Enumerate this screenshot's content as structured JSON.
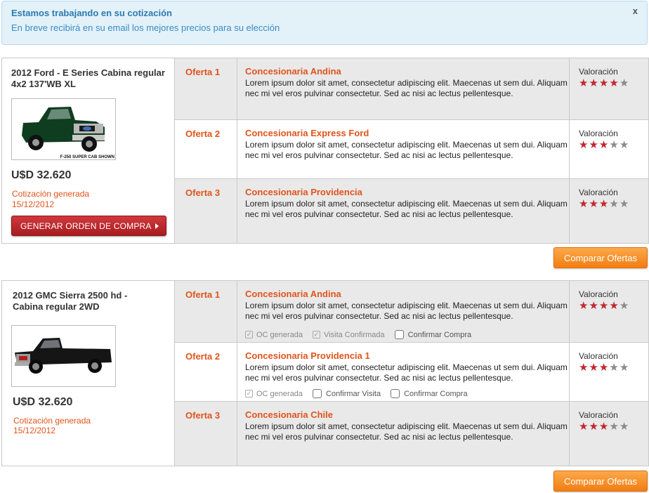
{
  "alert": {
    "title": "Estamos trabajando en su cotización",
    "text": "En breve recibirá en su email los mejores precios para su elección",
    "close": "x"
  },
  "quotes": [
    {
      "car_title": "2012 Ford - E Series Cabina regular 4x2 137'WB XL",
      "image_caption": "F-250 SUPER CAB SHOWN",
      "price": "U$D 32.620",
      "generated_label": "Cotización generada",
      "generated_date": "15/12/2012",
      "order_button": "GENERAR ORDEN DE COMPRA",
      "offers": [
        {
          "label": "Oferta 1",
          "dealer": "Concesionaria Andina",
          "desc": "Lorem ipsum dolor sit amet, consectetur adipiscing elit. Maecenas ut sem dui. Aliquam nec mi vel eros pulvinar consectetur. Sed ac nisi ac lectus pellentesque.",
          "rating_label": "Valoración",
          "stars": 4
        },
        {
          "label": "Oferta 2",
          "dealer": "Concesionaria Express Ford",
          "desc": "Lorem ipsum dolor sit amet, consectetur adipiscing elit. Maecenas ut sem dui. Aliquam nec mi vel eros pulvinar consectetur. Sed ac nisi ac lectus pellentesque.",
          "rating_label": "Valoración",
          "stars": 3
        },
        {
          "label": "Oferta 3",
          "dealer": "Concesionaria Providencia",
          "desc": "Lorem ipsum dolor sit amet, consectetur adipiscing elit. Maecenas ut sem dui. Aliquam nec mi vel eros pulvinar consectetur. Sed ac nisi ac lectus pellentesque.",
          "rating_label": "Valoración",
          "stars": 3
        }
      ],
      "compare_button": "Comparar Ofertas"
    },
    {
      "car_title": "2012 GMC Sierra 2500 hd - Cabina regular 2WD",
      "price": "U$D 32.620",
      "generated_label": "Cotización generada",
      "generated_date": "15/12/2012",
      "offers": [
        {
          "label": "Oferta 1",
          "dealer": "Concesionaria Andina",
          "desc": "Lorem ipsum dolor sit amet, consectetur adipiscing elit. Maecenas ut sem dui. Aliquam nec mi vel eros pulvinar consectetur. Sed ac nisi ac lectus pellentesque.",
          "rating_label": "Valoración",
          "stars": 4,
          "checks": [
            "OC generada",
            "Visita Confirmada",
            "Confirmar Compra"
          ]
        },
        {
          "label": "Oferta 2",
          "dealer": "Concesionaria Providencia 1",
          "desc": "Lorem ipsum dolor sit amet, consectetur adipiscing elit. Maecenas ut sem dui. Aliquam nec mi vel eros pulvinar consectetur. Sed ac nisi ac lectus pellentesque.",
          "rating_label": "Valoración",
          "stars": 3,
          "checks": [
            "OC generada",
            "Confirmar Visita",
            "Confirmar Compra"
          ]
        },
        {
          "label": "Oferta 3",
          "dealer": "Concesionaria Chile",
          "desc": "Lorem ipsum dolor sit amet, consectetur adipiscing elit. Maecenas ut sem dui. Aliquam nec mi vel eros pulvinar consectetur. Sed ac nisi ac lectus pellentesque.",
          "rating_label": "Valoración",
          "stars": 3
        }
      ],
      "compare_button": "Comparar Ofertas"
    }
  ],
  "colors": {
    "accent": "#e0541b",
    "star_on": "#c1272d",
    "star_off": "#8a8a8a",
    "order_button": "#b8242a",
    "compare_button": "#f58b20",
    "alert_bg": "#e3f1f9"
  }
}
